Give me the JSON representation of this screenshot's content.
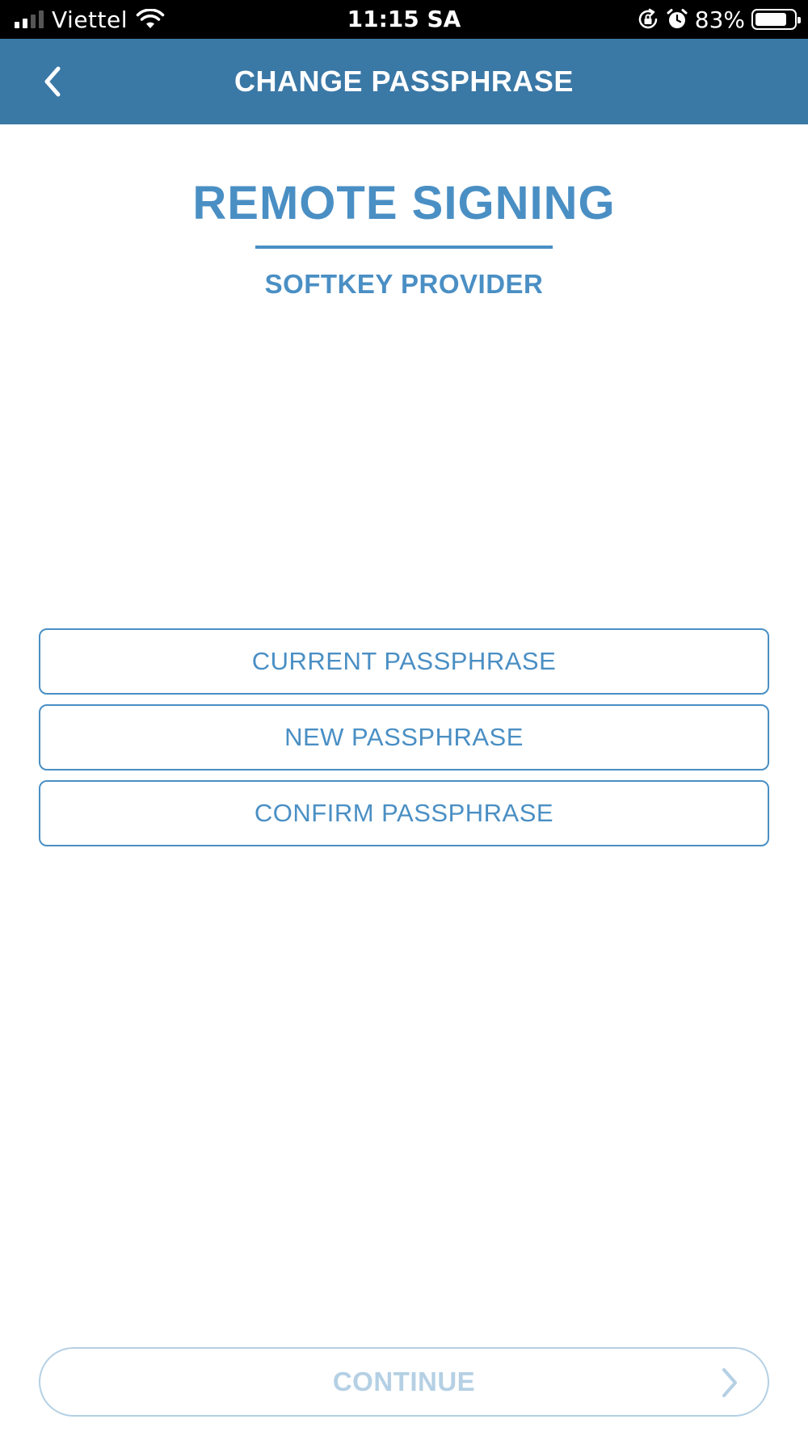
{
  "status_bar": {
    "carrier": "Viettel",
    "time": "11:15 SA",
    "battery_percent": "83%",
    "battery_level": 0.83,
    "icons": [
      "signal-icon",
      "wifi-icon",
      "orientation-lock-icon",
      "alarm-icon",
      "battery-icon"
    ]
  },
  "header": {
    "title": "CHANGE PASSPHRASE",
    "back_icon": "chevron-left-icon",
    "background_color": "#3a78a6"
  },
  "brand": {
    "title": "REMOTE SIGNING",
    "subtitle": "SOFTKEY PROVIDER",
    "color": "#4a8fc4"
  },
  "form": {
    "current_passphrase": {
      "value": "",
      "placeholder": "CURRENT PASSPHRASE"
    },
    "new_passphrase": {
      "value": "",
      "placeholder": "NEW PASSPHRASE"
    },
    "confirm_passphrase": {
      "value": "",
      "placeholder": "CONFIRM PASSPHRASE"
    }
  },
  "continue_button": {
    "label": "CONTINUE",
    "icon": "chevron-right-icon",
    "state": "disabled",
    "color": "#b5d0e4"
  }
}
